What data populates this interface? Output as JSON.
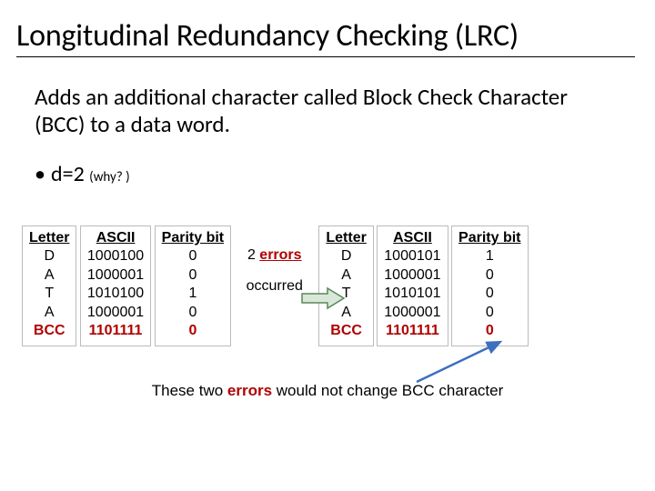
{
  "title": "Longitudinal Redundancy Checking (LRC)",
  "description": "Adds an additional character called Block Check Character (BCC) to a data word.",
  "bullet_prefix": "d=2 ",
  "bullet_why": "(why? )",
  "headers": {
    "letter": "Letter",
    "ascii": "ASCII",
    "parity": "Parity bit"
  },
  "left": {
    "rows": [
      {
        "letter": "D",
        "ascii": "1000100",
        "parity": "0"
      },
      {
        "letter": "A",
        "ascii": "1000001",
        "parity": "0"
      },
      {
        "letter": "T",
        "ascii": "1010100",
        "parity": "1"
      },
      {
        "letter": "A",
        "ascii": "1000001",
        "parity": "0"
      }
    ],
    "bcc": {
      "letter": "BCC",
      "ascii": "1101111",
      "parity": "0"
    }
  },
  "between": {
    "count": "2 ",
    "errors_word": "errors",
    "occurred": "occurred"
  },
  "right": {
    "rows": [
      {
        "letter": "D",
        "ascii": "1000101",
        "parity": "1"
      },
      {
        "letter": "A",
        "ascii": "1000001",
        "parity": "0"
      },
      {
        "letter": "T",
        "ascii": "1010101",
        "parity": "0"
      },
      {
        "letter": "A",
        "ascii": "1000001",
        "parity": "0"
      }
    ],
    "bcc": {
      "letter": "BCC",
      "ascii": "1101111",
      "parity": "0"
    }
  },
  "footer": {
    "pre": "These two ",
    "errors": "errors",
    "post": " would not change BCC character"
  }
}
